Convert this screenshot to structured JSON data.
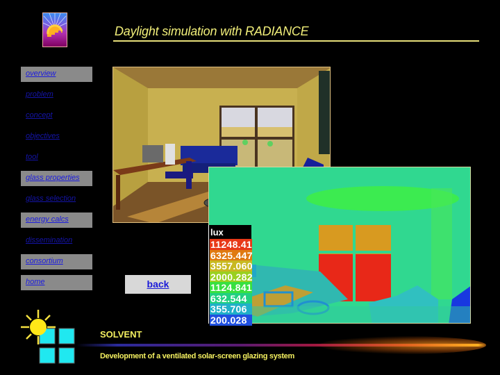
{
  "header": {
    "title": "Daylight simulation with RADIANCE",
    "logo_icon": "radiance-sun-logo-icon"
  },
  "nav": {
    "items": [
      {
        "label": "overview",
        "boxed": true
      },
      {
        "label": "problem",
        "boxed": false
      },
      {
        "label": "concept",
        "boxed": false
      },
      {
        "label": "objectives",
        "boxed": false
      },
      {
        "label": "tool",
        "boxed": false
      },
      {
        "label": "glass properties",
        "boxed": true
      },
      {
        "label": "glass selection",
        "boxed": false
      },
      {
        "label": "energy calcs",
        "boxed": true
      },
      {
        "label": "dissemination",
        "boxed": false
      },
      {
        "label": "consortium",
        "boxed": true
      },
      {
        "label": "home",
        "boxed": true
      }
    ]
  },
  "images": {
    "render_alt": "Rendered office interior with window, desk, blue sofa and chair",
    "falsecolor_alt": "False-color illuminance map of the same office"
  },
  "legend": {
    "unit": "lux",
    "values": [
      "11248.413",
      "6325.447",
      "3557.060",
      "2000.282",
      "1124.841",
      "632.544",
      "355.706",
      "200.028"
    ],
    "colors": [
      "#e83818",
      "#e07a10",
      "#c8b820",
      "#9ad020",
      "#38e040",
      "#20d080",
      "#20b0c8",
      "#2050e0"
    ]
  },
  "back_button": {
    "label": "back"
  },
  "footer": {
    "brand": "SOLVENT",
    "tagline": "Development of a ventilated solar-screen glazing system",
    "logo_icon": "sun-window-logo-icon"
  }
}
